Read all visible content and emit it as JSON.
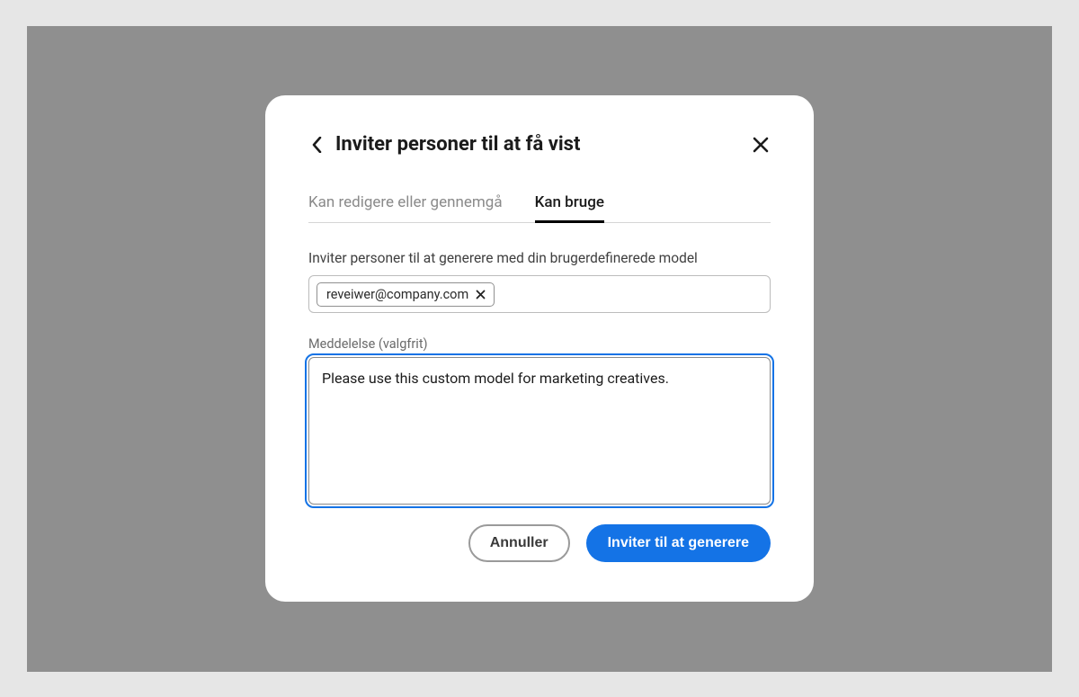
{
  "modal": {
    "title": "Inviter personer til at få vist",
    "tabs": [
      {
        "label": "Kan redigere eller gennemgå",
        "active": false
      },
      {
        "label": "Kan bruge",
        "active": true
      }
    ],
    "invite_label": "Inviter personer til at generere med din brugerdefinerede model",
    "email_chip": "reveiwer@company.com",
    "message_label": "Meddelelse (valgfrit)",
    "message_value": "Please use this custom model for marketing creatives.",
    "cancel_label": "Annuller",
    "submit_label": "Inviter til at generere"
  }
}
